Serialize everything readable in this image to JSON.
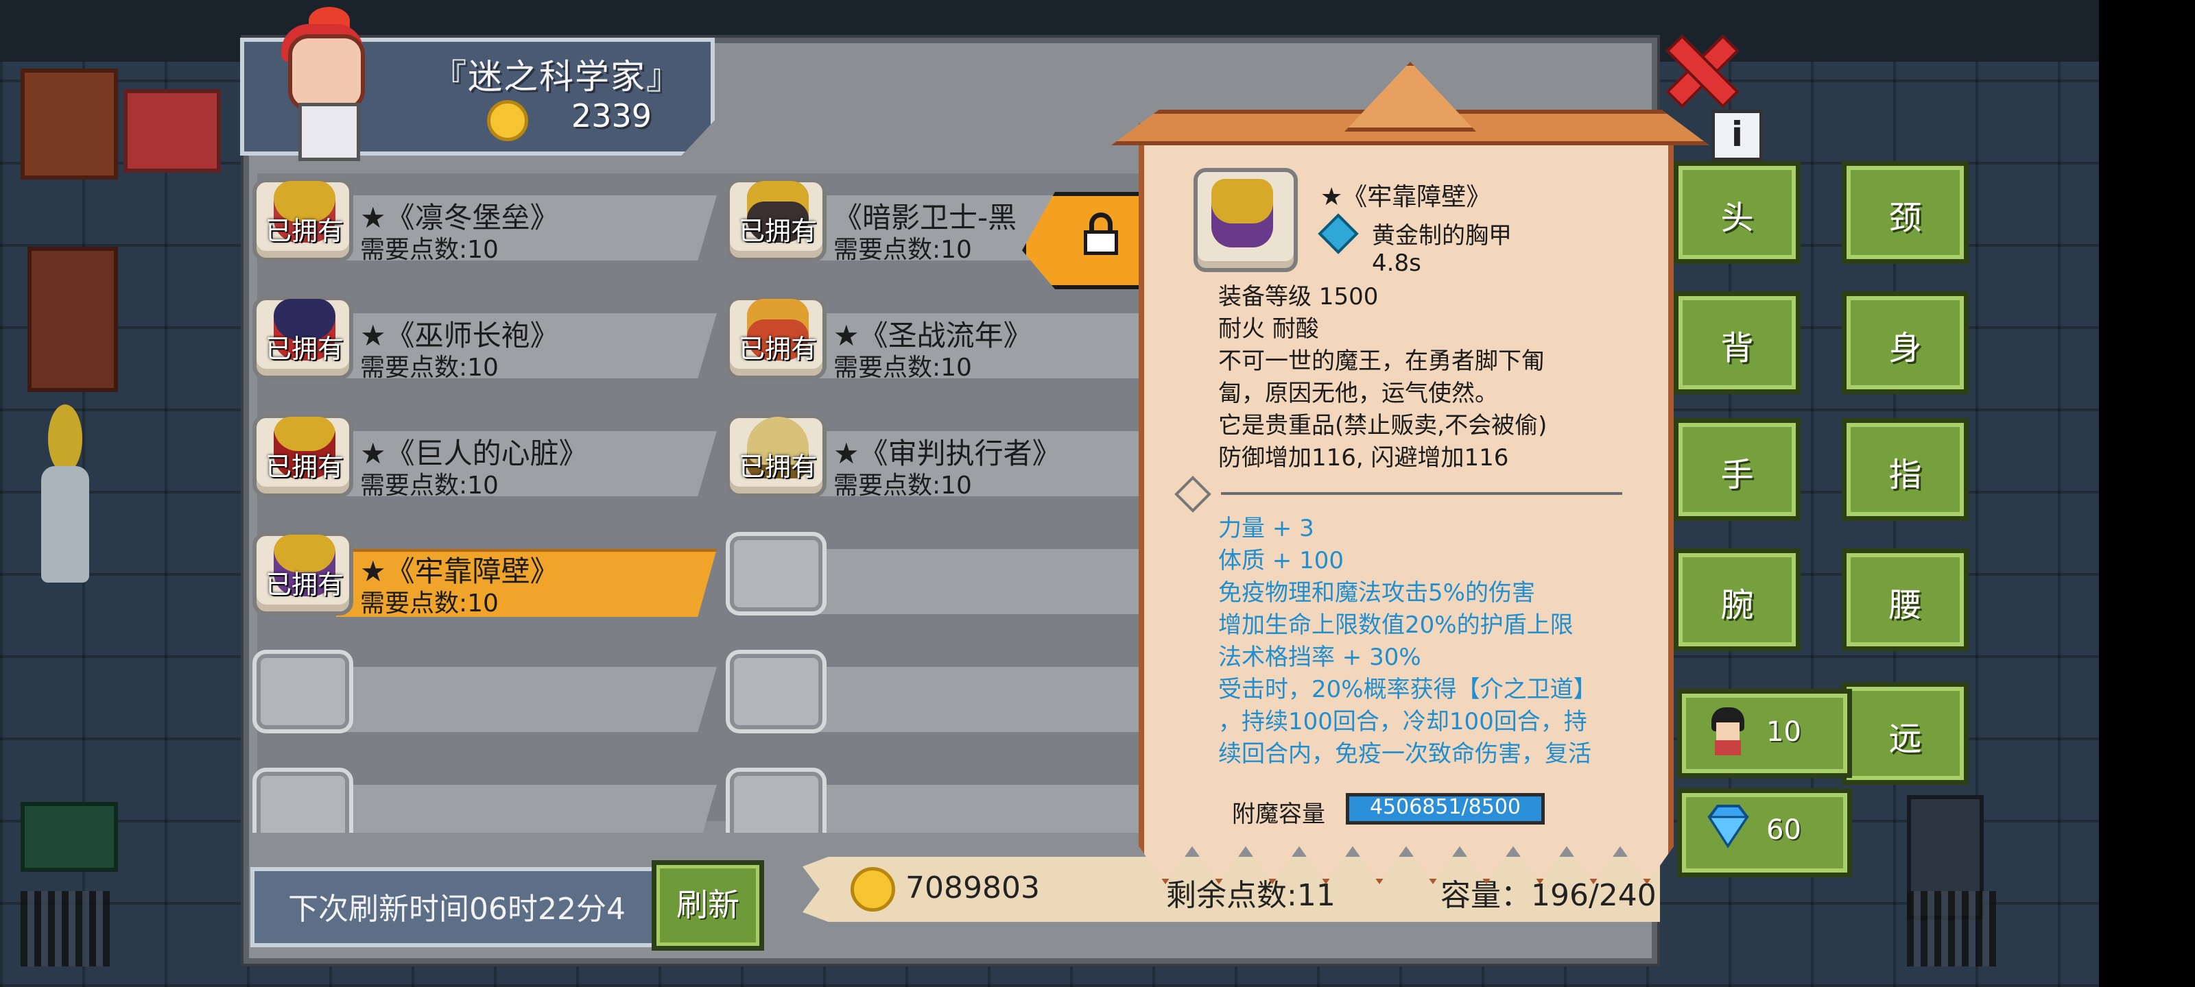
{
  "merchant": {
    "name": "『迷之科学家』",
    "coins": "2339"
  },
  "items": [
    {
      "status": "已拥有",
      "title": "★《凛冬堡垒》",
      "cost": "需要点数:10",
      "color": "#d7a928",
      "accent": "#b93434"
    },
    {
      "status": "已拥有",
      "title": "《暗影卫士-黑",
      "cost": "需要点数:10",
      "color": "#3a3030",
      "accent": "#d7a928"
    },
    {
      "status": "已拥有",
      "title": "★《巫师长袍》",
      "cost": "需要点数:10",
      "color": "#2d2b5e",
      "accent": "#c02a2a"
    },
    {
      "status": "已拥有",
      "title": "★《圣战流年》",
      "cost": "需要点数:10",
      "color": "#c84a2a",
      "accent": "#e0a030"
    },
    {
      "status": "已拥有",
      "title": "★《巨人的心脏》",
      "cost": "需要点数:10",
      "color": "#d7a928",
      "accent": "#a02020"
    },
    {
      "status": "已拥有",
      "title": "★《审判执行者》",
      "cost": "需要点数:10",
      "color": "#d8c27a",
      "accent": "#7a5a20"
    },
    {
      "status": "已拥有",
      "title": "★《牢靠障壁》",
      "cost": "需要点数:10",
      "color": "#d7a928",
      "accent": "#6a3a8a"
    }
  ],
  "refresh": {
    "label": "下次刷新时间06时22分4",
    "button": "刷新"
  },
  "footer": {
    "gold": "7089803",
    "points_left": "剩余点数:11",
    "capacity": "容量：196/240"
  },
  "tooltip": {
    "name": "★《牢靠障壁》",
    "type": "黄金制的胸甲",
    "speed": "4.8s",
    "lines": [
      "装备等级 1500",
      "耐火  耐酸",
      "不可一世的魔王，在勇者脚下匍",
      "匐，原因无他，运气使然。",
      "它是贵重品(禁止贩卖,不会被偷)",
      "防御增加116, 闪避增加116"
    ],
    "bonuses": [
      "力量 + 3",
      "体质 + 100",
      "免疫物理和魔法攻击5%的伤害",
      "增加生命上限数值20%的护盾上限",
      "法术格挡率 + 30%",
      "受击时，20%概率获得【介之卫道】",
      "，持续100回合，冷却100回合，持",
      "续回合内，免疫一次致命伤害，复活"
    ],
    "enchant_label": "附魔容量",
    "enchant_value": "4506851/8500"
  },
  "slots": [
    "头",
    "颈",
    "背",
    "身",
    "手",
    "指",
    "腕",
    "腰",
    "远"
  ],
  "stats": {
    "hero_count": "10",
    "gems": "60"
  },
  "colors": {
    "panel": "#8b8f94",
    "selected": "#f0a52a",
    "button_green": "#76a03e",
    "bonus_blue": "#1f8fd0",
    "close_red": "#e03434"
  }
}
